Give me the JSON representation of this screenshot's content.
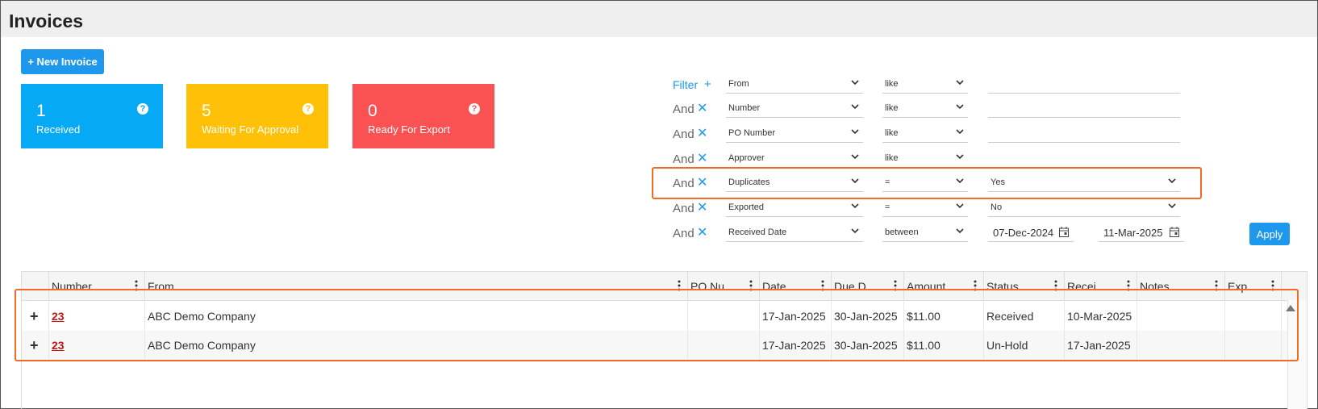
{
  "page": {
    "title": "Invoices"
  },
  "toolbar": {
    "new_invoice_label": "+ New Invoice"
  },
  "cards": [
    {
      "count": "1",
      "label": "Received",
      "color": "#06a9f4"
    },
    {
      "count": "5",
      "label": "Waiting For Approval",
      "color": "#ffc107"
    },
    {
      "count": "0",
      "label": "Ready For Export",
      "color": "#fa5252"
    }
  ],
  "filters": {
    "header_label": "Filter",
    "conjunction": "And",
    "rows": [
      {
        "field": "From",
        "operator": "like",
        "value": ""
      },
      {
        "field": "Number",
        "operator": "like",
        "value": ""
      },
      {
        "field": "PO Number",
        "operator": "like",
        "value": ""
      },
      {
        "field": "Approver",
        "operator": "like",
        "value": ""
      },
      {
        "field": "Duplicates",
        "operator": "=",
        "value": "Yes"
      },
      {
        "field": "Exported",
        "operator": "=",
        "value": "No"
      },
      {
        "field": "Received Date",
        "operator": "between",
        "value_from": "07-Dec-2024",
        "value_to": "11-Mar-2025"
      }
    ],
    "apply_label": "Apply"
  },
  "grid": {
    "columns": [
      "Number",
      "From",
      "PO Nu...",
      "Date",
      "Due D...",
      "Amount",
      "Status",
      "Recei...",
      "Notes",
      "Exp."
    ],
    "rows": [
      {
        "number": "23",
        "from": "ABC Demo Company",
        "po_number": "",
        "date": "17-Jan-2025",
        "due_date": "30-Jan-2025",
        "amount": "$11.00",
        "status": "Received",
        "received": "10-Mar-2025",
        "notes": "",
        "exp": ""
      },
      {
        "number": "23",
        "from": "ABC Demo Company",
        "po_number": "",
        "date": "17-Jan-2025",
        "due_date": "30-Jan-2025",
        "amount": "$11.00",
        "status": "Un-Hold",
        "received": "17-Jan-2025",
        "notes": "",
        "exp": ""
      }
    ]
  },
  "colors": {
    "accent": "#1e98ec",
    "highlight": "#f26a24",
    "link": "#c81313"
  }
}
